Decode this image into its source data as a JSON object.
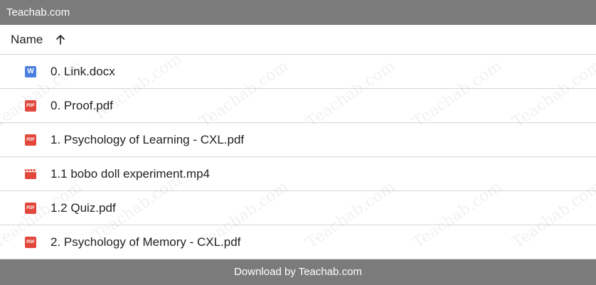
{
  "topbar": {
    "title": "Teachab.com"
  },
  "header": {
    "name_label": "Name",
    "sort_icon": "arrow-up-icon"
  },
  "files": [
    {
      "name": "0. Link.docx",
      "icon": "word-doc-icon",
      "icon_text": "W"
    },
    {
      "name": "0. Proof.pdf",
      "icon": "pdf-icon",
      "icon_text": "PDF"
    },
    {
      "name": "1. Psychology of Learning - CXL.pdf",
      "icon": "pdf-icon",
      "icon_text": "PDF"
    },
    {
      "name": "1.1 bobo doll experiment.mp4",
      "icon": "video-icon",
      "icon_text": ""
    },
    {
      "name": "1.2 Quiz.pdf",
      "icon": "pdf-icon",
      "icon_text": "PDF"
    },
    {
      "name": "2. Psychology of Memory - CXL.pdf",
      "icon": "pdf-icon",
      "icon_text": "PDF"
    }
  ],
  "footer": {
    "text": "Download by Teachab.com"
  },
  "watermark": {
    "text": "Teachab.com"
  },
  "colors": {
    "bar": "#7b7b7b",
    "word": "#4a7fe0",
    "pdf": "#e3473b",
    "video": "#e3473b"
  }
}
